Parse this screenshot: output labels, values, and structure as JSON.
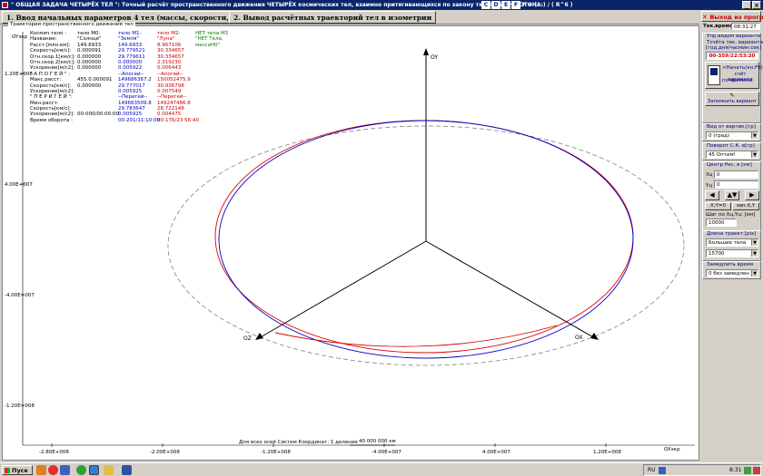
{
  "window": {
    "title": "\" ОБЩАЯ ЗАДАЧА ЧЕТЫРЁХ ТЕЛ \": Точный расчёт пространственного движения ЧЕТЫРЁХ космических тел, взаимно притягивающихся по закону тяготения НЬЮТОНА:",
    "title_tail": "F = (...) / ( R^6 )",
    "mini_tabs": [
      "C",
      "D",
      "E",
      "F"
    ]
  },
  "menu": {
    "tab1": "1. Ввод начальных параметров 4 тел (массы, скорости, расстояния)",
    "tab2": "2. Вывод расчётных траекторий тел в изометрии",
    "exit": "Выход из прогр."
  },
  "panel": {
    "caption": "Траектории пространственного движения тел"
  },
  "info": {
    "rows": [
      [
        "Космич.тело :",
        "тело M0:",
        "тело M1:",
        "тело M2:",
        "НЕТ тела M3"
      ],
      [
        "Название:",
        "\"Солнце\"",
        "\"Земля\"",
        "\"Луна\"",
        "\"НЕТ Тела,"
      ],
      [
        "Расст.[млн.км]:",
        "149.6933",
        "149.6933",
        "8.967106",
        "массаН0\""
      ],
      [
        "Скорость[км/с]:",
        "0.000091",
        "29.779521",
        "30.334657",
        ""
      ],
      [
        "Отн.скор.1[км/с]:",
        "0.000000",
        "29.779611",
        "30.334657",
        ""
      ],
      [
        "Отн.скор.2[км/с]:",
        "0.000000",
        "0.000000",
        "2.319230",
        ""
      ],
      [
        "Ускорение[м/с2]:",
        "0.000000",
        "0.005922",
        "0.006443",
        ""
      ],
      [
        "\" А П О Г Е Й \" :",
        "",
        "--Апогей--",
        "--Апогей--",
        ""
      ],
      [
        "Макс.расст:",
        "455.0.000091",
        "149686367.2",
        "150052475.9",
        ""
      ],
      [
        "Скорость[км/с]:",
        "0.000000",
        "29.777017",
        "30.936798",
        ""
      ],
      [
        "Ускорение[м/с2]:",
        "",
        "0.005925",
        "0.007549",
        ""
      ],
      [
        "\" П Е Р И Г Е Й \":",
        "",
        "--Перигей--",
        "--Перигей--",
        ""
      ],
      [
        "Мин.расст:",
        "",
        "149663509.8",
        "149247486.8",
        ""
      ],
      [
        "Скорость[км/с]:",
        "",
        "29.783647",
        "28.722148",
        ""
      ],
      [
        "Ускорение[м/с2]:",
        "00-000/00:00:00",
        "0.005925",
        "0.004475",
        ""
      ],
      [
        "Время оборота :",
        "",
        "00-201/11:10:00",
        "00-176/23:56:40",
        ""
      ]
    ]
  },
  "plot": {
    "axis_y_label": "OY",
    "axis_x_label": "OX",
    "axis_z_label": "OZ",
    "left_top_label": "OYэкр",
    "right_bottom_label": "OXэкр",
    "y_ticks": [
      "1.20E+008",
      "4.00E+007",
      "-4.00E+007",
      "-1.20E+008"
    ],
    "x_ticks": [
      "-2.80E+008",
      "-2.00E+008",
      "-1.20E+008",
      "-4.00E+007",
      "4.00E+007",
      "1.20E+008"
    ],
    "scale_note": "Для всех осей Систем Координат: 1 деление",
    "scale_value": "40 000 000 км",
    "colors": {
      "earth": "#0000cc",
      "moon": "#dd0000",
      "orbit_guide": "#808080",
      "axes": "#000000"
    }
  },
  "sidebar": {
    "time_label": "Тек.время",
    "time_value": "08:31:27",
    "control_group": "Упр.видом варианта",
    "save_caption_1": "Тсчёта тек. варианта",
    "save_caption_2": "[год.дня/часмин:сек]",
    "save_value": "00-359/22:53:20",
    "start_btn_1": "<Начать(кн.F9)",
    "start_btn_2": "счёт варианта",
    "start_btn_3": "по времени",
    "remember_btn": "Запомнить вариант",
    "view_group": "Вид от вертик.[гр]",
    "view_value": "0  (град)",
    "rotate_group": "Поворот С.К. в[гр]",
    "rotate_value": "45 Оптим!",
    "center_group": "Центр Рис. в [км]",
    "xc_label": "Xц",
    "xc_value": "0",
    "yc_label": "Yц",
    "yc_value": "0",
    "reset_btn": "Х,Y=0",
    "recall_btn": "зап.Х,Y",
    "step_label": "Шаг по Хц,Yц: [км]",
    "step_value": "10000",
    "traj_group": "Длина траект.[pix]",
    "traj_value_1": "Большие тела",
    "traj_value_2": "15700",
    "slow_group": "Замедлить время",
    "slow_value": "0 без замедлен"
  },
  "taskbar": {
    "start": "Пуск",
    "lang": "RU",
    "clock": "8:31"
  }
}
